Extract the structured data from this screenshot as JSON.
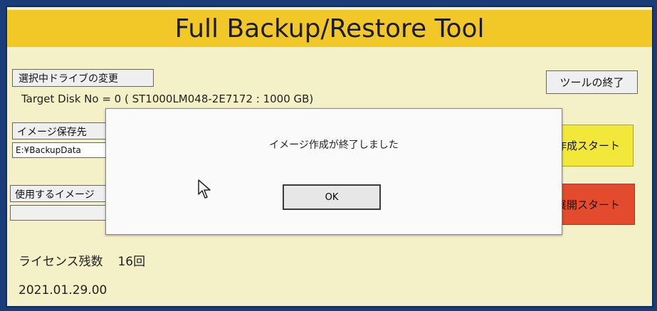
{
  "app": {
    "title": "Full Backup/Restore Tool",
    "change_drive_label": "選択中ドライブの変更",
    "exit_label": "ツールの終了",
    "target_disk_text": "Target Disk No = 0 ( ST1000LM048-2E7172 : 1000 GB)",
    "image_save_label": "イメージ保存先",
    "image_save_path": "E:¥BackupData",
    "create_start_label": "作成スタート",
    "use_image_label": "使用するイメージ",
    "use_image_value": "",
    "deploy_start_label": "展開スタート",
    "license_label": "ライセンス残数",
    "license_count": "16回",
    "version": "2021.01.29.00"
  },
  "dialog": {
    "message": "イメージ作成が終了しました",
    "ok_label": "OK"
  },
  "colors": {
    "title_bar": "#f1c827",
    "background": "#f4f0c8",
    "create_button": "#f2e83a",
    "deploy_button": "#e24b2b",
    "monitor_border": "#1a3d7a"
  }
}
